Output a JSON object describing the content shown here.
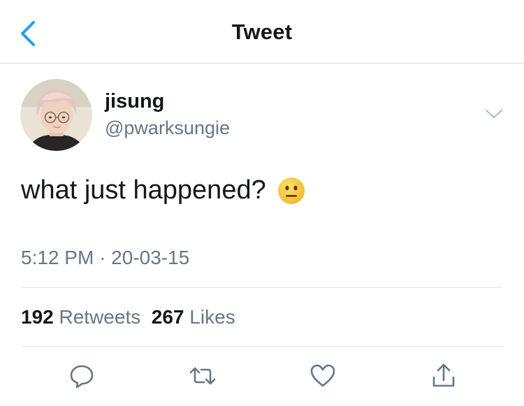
{
  "header": {
    "title": "Tweet",
    "back_icon": "chevron-left-icon"
  },
  "author": {
    "name": "jisung",
    "handle": "@pwarksungie"
  },
  "tweet": {
    "text": "what just happened?",
    "emoji": "neutral-face-emoji"
  },
  "meta": {
    "time": "5:12 PM",
    "separator": "·",
    "date": "20-03-15"
  },
  "stats": {
    "retweets_count": "192",
    "retweets_label": "Retweets",
    "likes_count": "267",
    "likes_label": "Likes"
  },
  "actions": [
    "reply-icon",
    "retweet-icon",
    "like-icon",
    "share-icon"
  ],
  "colors": {
    "accent": "#1da1f2",
    "text": "#14171a",
    "secondary": "#657786",
    "divider": "#e1e4e7"
  }
}
